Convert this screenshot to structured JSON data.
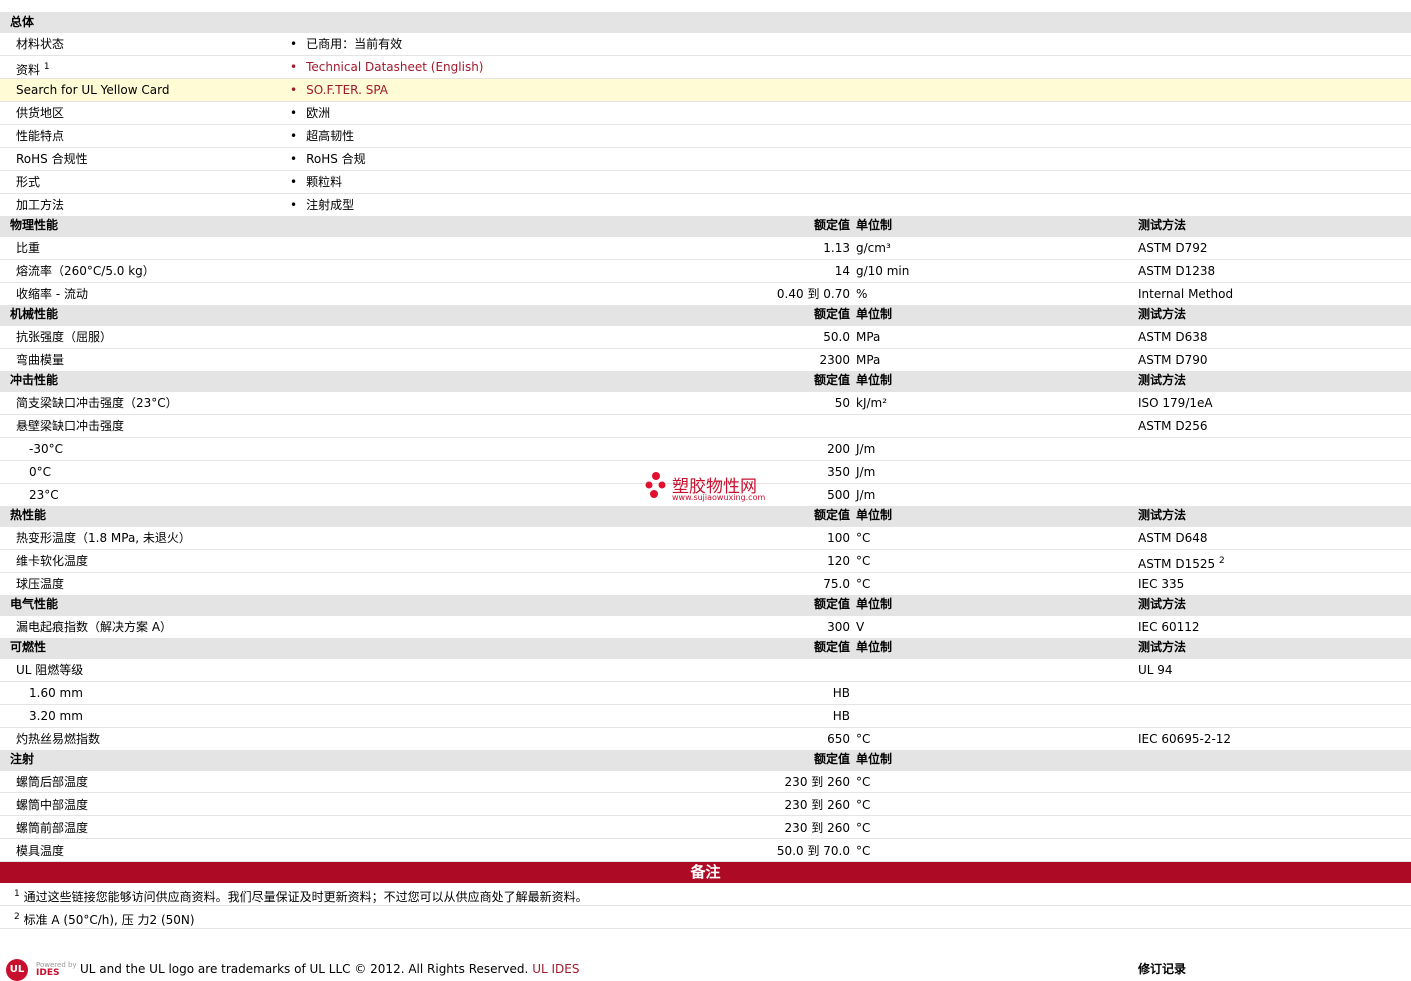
{
  "general": {
    "header": "总体",
    "rows": [
      {
        "label": "材料状态",
        "value": "已商用：当前有效"
      },
      {
        "label": "资料",
        "sup": "1",
        "value": "Technical Datasheet (English)",
        "link": true
      },
      {
        "label": "Search for UL Yellow Card",
        "value": "SO.F.TER. SPA",
        "link": true,
        "highlight": true
      },
      {
        "label": "供货地区",
        "value": "欧洲"
      },
      {
        "label": "性能特点",
        "value": "超高韧性"
      },
      {
        "label": "RoHS 合规性",
        "value": "RoHS 合规"
      },
      {
        "label": "形式",
        "value": "颗粒料"
      },
      {
        "label": "加工方法",
        "value": "注射成型"
      }
    ]
  },
  "col_headers": {
    "value": "额定值",
    "unit": "单位制",
    "method": "测试方法"
  },
  "sections": [
    {
      "title": "物理性能",
      "method_header": true,
      "rows": [
        {
          "label": "比重",
          "value": "1.13",
          "unit": "g/cm³",
          "method": "ASTM D792"
        },
        {
          "label": "熔流率（260°C/5.0 kg）",
          "value": "14",
          "unit": "g/10 min",
          "method": "ASTM D1238"
        },
        {
          "label": "收缩率 - 流动",
          "value": "0.40 到  0.70",
          "unit": "%",
          "method": "Internal Method"
        }
      ]
    },
    {
      "title": "机械性能",
      "method_header": true,
      "rows": [
        {
          "label": "抗张强度（屈服）",
          "value": "50.0",
          "unit": "MPa",
          "method": "ASTM D638"
        },
        {
          "label": "弯曲模量",
          "value": "2300",
          "unit": "MPa",
          "method": "ASTM D790"
        }
      ]
    },
    {
      "title": "冲击性能",
      "method_header": true,
      "rows": [
        {
          "label": "简支梁缺口冲击强度（23°C）",
          "value": "50",
          "unit": "kJ/m²",
          "method": "ISO 179/1eA"
        },
        {
          "label": "悬壁梁缺口冲击强度",
          "value": "",
          "unit": "",
          "method": "ASTM D256"
        },
        {
          "label": "-30°C",
          "indent": true,
          "value": "200",
          "unit": "J/m",
          "method": ""
        },
        {
          "label": "0°C",
          "indent": true,
          "value": "350",
          "unit": "J/m",
          "method": ""
        },
        {
          "label": "23°C",
          "indent": true,
          "value": "500",
          "unit": "J/m",
          "method": ""
        }
      ]
    },
    {
      "title": "热性能",
      "method_header": true,
      "rows": [
        {
          "label": "热变形温度（1.8 MPa, 未退火）",
          "value": "100",
          "unit": "°C",
          "method": "ASTM D648"
        },
        {
          "label": "维卡软化温度",
          "value": "120",
          "unit": "°C",
          "method": "ASTM D1525",
          "method_sup": "2"
        },
        {
          "label": "球压温度",
          "value": "75.0",
          "unit": "°C",
          "method": "IEC 335"
        }
      ]
    },
    {
      "title": "电气性能",
      "method_header": true,
      "rows": [
        {
          "label": "漏电起痕指数（解决方案  A）",
          "value": "300",
          "unit": "V",
          "method": "IEC 60112"
        }
      ]
    },
    {
      "title": "可燃性",
      "method_header": true,
      "rows": [
        {
          "label": "UL 阻燃等级",
          "value": "",
          "unit": "",
          "method": "UL 94"
        },
        {
          "label": "1.60 mm",
          "indent": true,
          "value": "HB",
          "unit": "",
          "method": ""
        },
        {
          "label": "3.20 mm",
          "indent": true,
          "value": "HB",
          "unit": "",
          "method": ""
        },
        {
          "label": "灼热丝易燃指数",
          "value": "650",
          "unit": "°C",
          "method": "IEC 60695-2-12"
        }
      ]
    },
    {
      "title": "注射",
      "method_header": false,
      "rows": [
        {
          "label": "螺筒后部温度",
          "value": "230 到  260",
          "unit": "°C",
          "method": ""
        },
        {
          "label": "螺筒中部温度",
          "value": "230 到  260",
          "unit": "°C",
          "method": ""
        },
        {
          "label": "螺筒前部温度",
          "value": "230 到  260",
          "unit": "°C",
          "method": ""
        },
        {
          "label": "模具温度",
          "value": "50.0 到  70.0",
          "unit": "°C",
          "method": ""
        }
      ]
    }
  ],
  "notes": {
    "title": "备注",
    "items": [
      {
        "num": "1",
        "text": "通过这些链接您能够访问供应商资料。我们尽量保证及时更新资料；不过您可以从供应商处了解最新资料。"
      },
      {
        "num": "2",
        "text": "标准  A (50°C/h), 压  力2 (50N)"
      }
    ]
  },
  "watermark": {
    "text": "塑胶物性网",
    "url": "www.sujiaowuxing.com"
  },
  "footer": {
    "logo": "UL",
    "powered_by": "Powered by",
    "brand": "IDES",
    "text": "UL and the UL logo are trademarks of UL LLC © 2012. All Rights Reserved.",
    "link": "UL IDES",
    "revision": "修订记录"
  }
}
